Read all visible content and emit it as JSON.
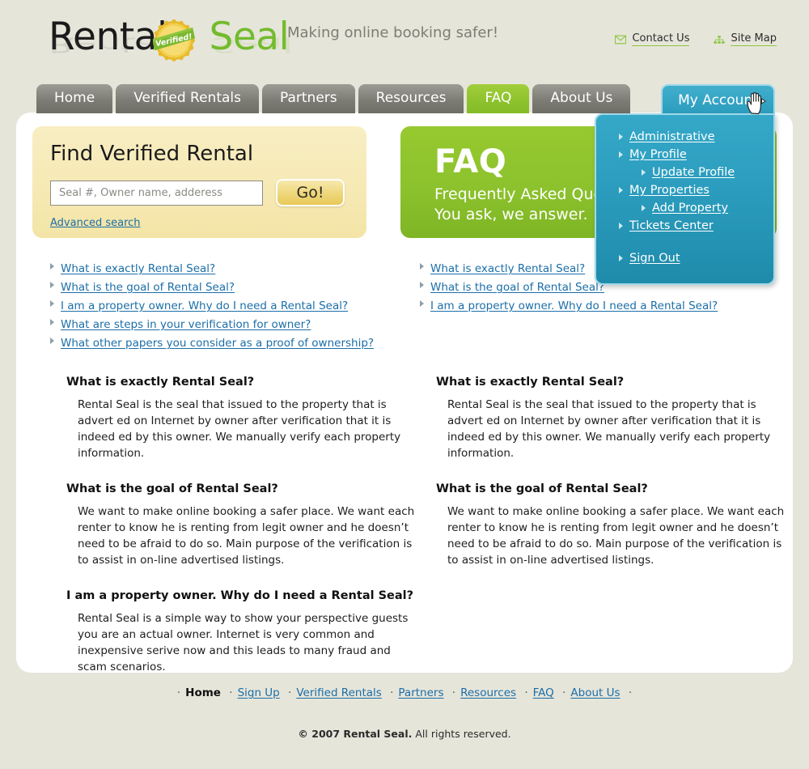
{
  "brand": {
    "name_part1": "Rental",
    "name_part2": "Seal",
    "seal_text": "Verified!",
    "tagline": "Making online booking safer!"
  },
  "header": {
    "links": [
      {
        "label": "Contact Us",
        "icon": "envelope-icon"
      },
      {
        "label": "Site Map",
        "icon": "sitemap-icon"
      }
    ]
  },
  "nav": {
    "tabs": [
      {
        "label": "Home",
        "active": false
      },
      {
        "label": "Verified Rentals",
        "active": false
      },
      {
        "label": "Partners",
        "active": false
      },
      {
        "label": "Resources",
        "active": false
      },
      {
        "label": "FAQ",
        "active": true
      },
      {
        "label": "About Us",
        "active": false
      }
    ],
    "account": {
      "label": "My Account",
      "menu": [
        {
          "label": "Administrative",
          "sub": false
        },
        {
          "label": "My Profile",
          "sub": false
        },
        {
          "label": "Update Profile",
          "sub": true
        },
        {
          "label": "My Properties",
          "sub": false
        },
        {
          "label": "Add Property",
          "sub": true
        },
        {
          "label": "Tickets Center",
          "sub": false
        },
        {
          "label": "Sign Out",
          "sub": false,
          "spaced": true
        }
      ]
    }
  },
  "search": {
    "title": "Find Verified Rental",
    "placeholder": "Seal #, Owner name, adderess",
    "value": "",
    "button_label": "Go!",
    "advanced_label": "Advanced search"
  },
  "banner": {
    "title": "FAQ",
    "line1": "Frequently Asked Questions.",
    "line2": "You ask, we answer."
  },
  "questions_left": [
    "What is exactly Rental Seal?",
    "What is the goal of Rental Seal?",
    "I am a property owner. Why do I need a Rental Seal?",
    "What are steps in your verification for owner?",
    "What other papers you consider as a proof of ownership?"
  ],
  "questions_right": [
    "What is exactly Rental Seal?",
    "What is the goal of Rental Seal?",
    "I am a property owner. Why do I need a Rental Seal?"
  ],
  "articles_left": [
    {
      "heading": "What is exactly Rental Seal?",
      "body": "Rental Seal is the seal that issued to the property that is advert ed on Internet by owner after verification that it is indeed ed by this owner. We manually verify each property information."
    },
    {
      "heading": "What is the goal of Rental Seal?",
      "body": "We want to make online booking a safer place. We want each renter to know he is renting from legit owner and he doesn’t need to be afraid to do so. Main purpose of the verification is to assist in on-line advertised listings."
    },
    {
      "heading": "I am a property owner. Why do I need a Rental Seal?",
      "body": "Rental Seal is a simple way to show your perspective guests you are an actual owner. Internet is very common and inexpensive serive now and this leads to many fraud and scam scenarios."
    }
  ],
  "articles_right": [
    {
      "heading": "What is exactly Rental Seal?",
      "body": "Rental Seal is the seal that issued to the property that is advert ed on Internet by owner after verification that it is indeed ed by this owner. We manually verify each property information."
    },
    {
      "heading": "What is the goal of Rental Seal?",
      "body": "We want to make online booking a safer place. We want each renter to know he is renting from legit owner and he doesn’t need to be afraid to do so. Main purpose of the verification is to assist in on-line advertised listings."
    }
  ],
  "footer": {
    "items": [
      {
        "label": "Home",
        "current": true
      },
      {
        "label": "Sign Up",
        "current": false
      },
      {
        "label": "Verified Rentals",
        "current": false
      },
      {
        "label": "Partners",
        "current": false
      },
      {
        "label": "Resources",
        "current": false
      },
      {
        "label": "FAQ",
        "current": false
      },
      {
        "label": "About Us",
        "current": false
      }
    ],
    "copyright_bold": "© 2007 Rental Seal.",
    "copyright_rest": " All rights reserved."
  },
  "colors": {
    "page_bg": "#e6e5da",
    "brand_green": "#73bb2e",
    "tab_green": "#8cc22d",
    "account_blue": "#2b9cbd",
    "search_cream": "#f6e9b4",
    "link_blue": "#1b6ea8"
  }
}
